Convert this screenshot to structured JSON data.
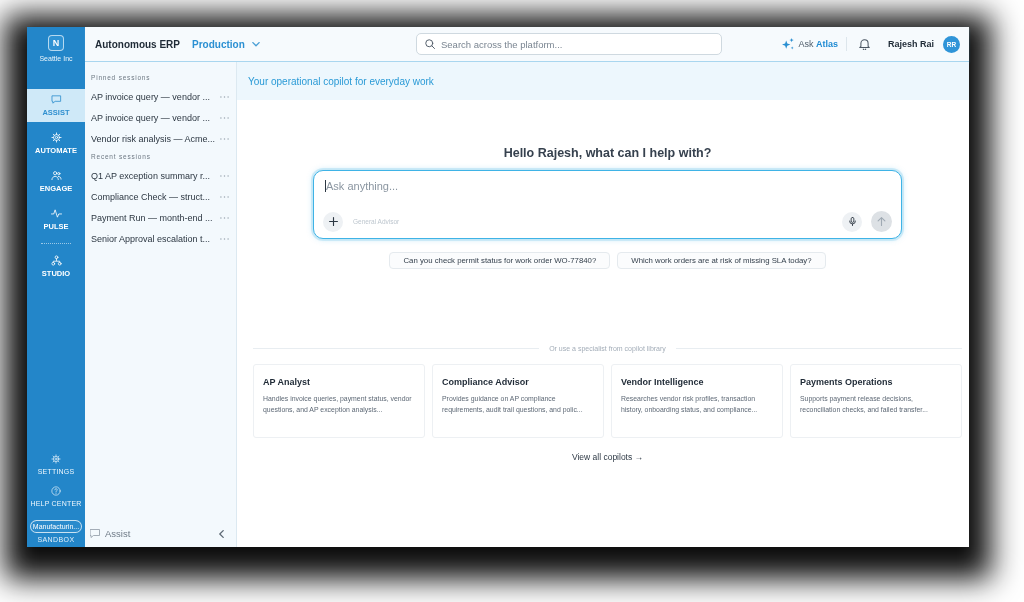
{
  "rail": {
    "logo": "N",
    "org": "Seattle Inc",
    "nav_groups": [
      [
        {
          "label": "ASSIST",
          "selected": true
        },
        {
          "label": "AUTOMATE",
          "selected": false
        },
        {
          "label": "ENGAGE",
          "selected": false
        },
        {
          "label": "PULSE",
          "selected": false
        }
      ],
      [
        {
          "label": "STUDIO",
          "selected": false
        }
      ]
    ],
    "footer_links": [
      "SETTINGS",
      "HELP CENTER"
    ],
    "workspace": "Manufacturin...",
    "environment_badge": "SANDBOX"
  },
  "header": {
    "app_name": "Autonomous ERP",
    "environment": "Production",
    "search": {
      "placeholder": "Search across the platform..."
    },
    "ask_button": "Ask **Atlas**",
    "user": {
      "name": "Rajesh Rai",
      "initials": "RR"
    }
  },
  "sessions": {
    "groups": [
      {
        "title": "Pinned sessions",
        "items": [
          "AP invoice query — vendor ...",
          "AP invoice query — vendor ...",
          "Vendor risk analysis — Acme..."
        ]
      },
      {
        "title": "Recent sessions",
        "items": [
          "Q1 AP exception summary r...",
          "Compliance Check — struct...",
          "Payment Run — month-end ...",
          "Senior Approval escalation t..."
        ]
      }
    ],
    "footer_label": "Assist"
  },
  "main": {
    "banner": "Your operational copilot for everyday work",
    "greeting": "Hello Rajesh, what can I help with?",
    "composer": {
      "placeholder": "Ask anything...",
      "focused": true,
      "advisor": "General Advisor",
      "send_disabled": true
    },
    "suggestions": [
      "Can you check permit status for work order WO-77840?",
      "Which work orders are at risk of missing SLA today?"
    ],
    "library": {
      "divider_label": "Or use a specialist from copilot library",
      "copilots": [
        {
          "title": "AP Analyst",
          "description": "Handles invoice queries, payment status, vendor questions, and AP exception analysis..."
        },
        {
          "title": "Compliance Advisor",
          "description": "Provides guidance on AP compliance requirements, audit trail questions, and polic..."
        },
        {
          "title": "Vendor Intelligence",
          "description": "Researches vendor risk profiles, transaction history, onboarding status, and compliance..."
        },
        {
          "title": "Payments Operations",
          "description": "Supports payment release decisions, reconciliation checks, and failed transfer..."
        }
      ],
      "view_all": "View all copilots →"
    }
  }
}
